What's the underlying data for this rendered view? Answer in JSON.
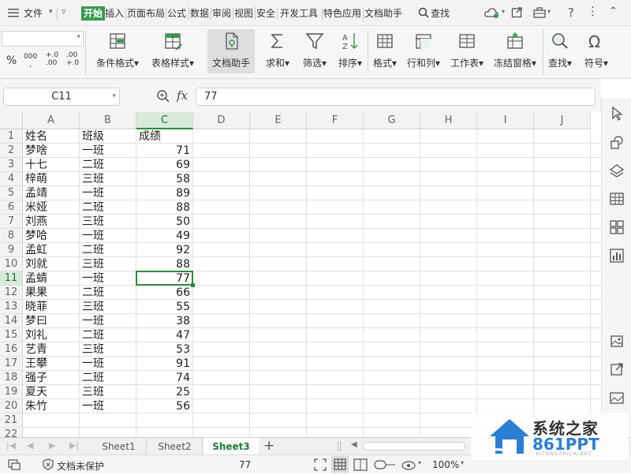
{
  "menu": {
    "file": "文件",
    "tabs": [
      "开始",
      "插入",
      "页面布局",
      "公式",
      "数据",
      "审阅",
      "视图",
      "安全",
      "开发工具",
      "特色应用",
      "文档助手"
    ],
    "active_tab": "开始",
    "search": "查找"
  },
  "ribbon": {
    "buttons": [
      {
        "label": "条件格式",
        "icon": "conditional-format-icon"
      },
      {
        "label": "表格样式",
        "icon": "table-style-icon"
      },
      {
        "label": "文档助手",
        "icon": "doc-assistant-icon"
      },
      {
        "label": "求和",
        "icon": "sum-icon"
      },
      {
        "label": "筛选",
        "icon": "filter-icon"
      },
      {
        "label": "排序",
        "icon": "sort-icon"
      },
      {
        "label": "格式",
        "icon": "format-icon"
      },
      {
        "label": "行和列",
        "icon": "rows-cols-icon"
      },
      {
        "label": "工作表",
        "icon": "worksheet-icon"
      },
      {
        "label": "冻结窗格",
        "icon": "freeze-icon"
      },
      {
        "label": "查找",
        "icon": "find-icon"
      },
      {
        "label": "符号",
        "icon": "symbol-icon"
      }
    ],
    "number_format": {
      "percent": "%",
      "thousands": "000",
      "inc_decimal": "+.0 .00",
      "dec_decimal": ".00 +.0"
    }
  },
  "formula_bar": {
    "cell_ref": "C11",
    "fx": "fx",
    "value": "77"
  },
  "grid": {
    "columns": [
      "A",
      "B",
      "C",
      "D",
      "E",
      "F",
      "G",
      "H",
      "I",
      "J"
    ],
    "selected_column": "C",
    "selected_row": 11,
    "rows": [
      {
        "n": "1",
        "a": "姓名",
        "b": "班级",
        "c": "成绩"
      },
      {
        "n": "2",
        "a": "梦啥",
        "b": "一班",
        "c": "71"
      },
      {
        "n": "3",
        "a": "十七",
        "b": "二班",
        "c": "69"
      },
      {
        "n": "4",
        "a": "梓萌",
        "b": "三班",
        "c": "58"
      },
      {
        "n": "5",
        "a": "孟靖",
        "b": "一班",
        "c": "89"
      },
      {
        "n": "6",
        "a": "米娅",
        "b": "二班",
        "c": "88"
      },
      {
        "n": "7",
        "a": "刘燕",
        "b": "三班",
        "c": "50"
      },
      {
        "n": "8",
        "a": "梦哈",
        "b": "一班",
        "c": "49"
      },
      {
        "n": "9",
        "a": "孟虹",
        "b": "二班",
        "c": "92"
      },
      {
        "n": "10",
        "a": "刘就",
        "b": "三班",
        "c": "88"
      },
      {
        "n": "11",
        "a": "孟蜻",
        "b": "一班",
        "c": "77"
      },
      {
        "n": "12",
        "a": "果果",
        "b": "二班",
        "c": "66"
      },
      {
        "n": "13",
        "a": "晓菲",
        "b": "三班",
        "c": "55"
      },
      {
        "n": "14",
        "a": "梦曰",
        "b": "一班",
        "c": "38"
      },
      {
        "n": "15",
        "a": "刘礼",
        "b": "二班",
        "c": "47"
      },
      {
        "n": "16",
        "a": "艺青",
        "b": "三班",
        "c": "53"
      },
      {
        "n": "17",
        "a": "王攀",
        "b": "一班",
        "c": "91"
      },
      {
        "n": "18",
        "a": "强子",
        "b": "二班",
        "c": "74"
      },
      {
        "n": "19",
        "a": "夏天",
        "b": "三班",
        "c": "25"
      },
      {
        "n": "20",
        "a": "朱竹",
        "b": "一班",
        "c": "56"
      },
      {
        "n": "21",
        "a": "",
        "b": "",
        "c": ""
      },
      {
        "n": "22",
        "a": "",
        "b": "",
        "c": ""
      }
    ]
  },
  "sheets": {
    "tabs": [
      "Sheet1",
      "Sheet2",
      "Sheet3"
    ],
    "active": "Sheet3",
    "add": "+"
  },
  "status": {
    "protect": "文档未保护",
    "value": "77",
    "zoom": "100%"
  },
  "watermark": {
    "title": "系统之家",
    "brand": "861PPT",
    "url": "XITONGZHIJIA.NET"
  },
  "colors": {
    "accent": "#2e8b3e",
    "active_tab_bg": "#3a9a50"
  }
}
